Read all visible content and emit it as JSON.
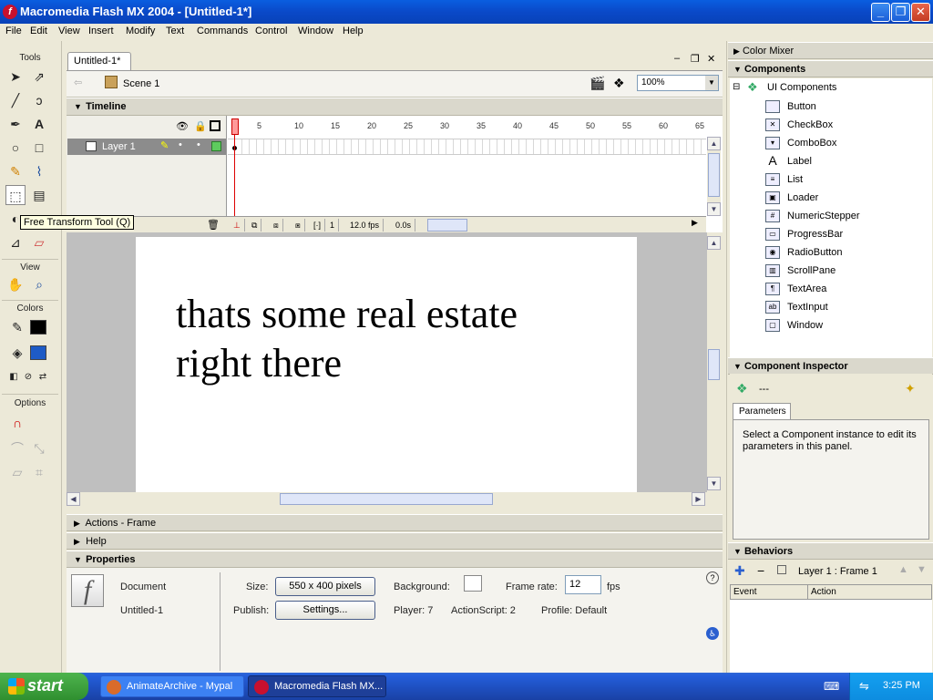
{
  "window": {
    "title": "Macromedia Flash MX 2004 - [Untitled-1*]",
    "minimize": "_",
    "restore": "❐",
    "close": "✕"
  },
  "menu": [
    "File",
    "Edit",
    "View",
    "Insert",
    "Modify",
    "Text",
    "Commands",
    "Control",
    "Window",
    "Help"
  ],
  "tools": {
    "header": "Tools",
    "view_header": "View",
    "colors_header": "Colors",
    "options_header": "Options",
    "tooltip": "Free Transform Tool (Q)",
    "stroke_color": "#000000",
    "fill_color": "#1e5bc6"
  },
  "document": {
    "tab": "Untitled-1*",
    "scene": "Scene 1",
    "zoom": "100%",
    "timeline_title": "Timeline",
    "layer_name": "Layer 1",
    "frame_numbers": [
      "1",
      "5",
      "10",
      "15",
      "20",
      "25",
      "30",
      "35",
      "40",
      "45",
      "50",
      "55",
      "60",
      "65"
    ],
    "current_frame": "1",
    "fps": "12.0 fps",
    "time": "0.0s",
    "stage_text_line1": "thats some real estate",
    "stage_text_line2": "right there"
  },
  "panels": {
    "actions": "Actions - Frame",
    "help": "Help",
    "properties": "Properties"
  },
  "properties": {
    "type": "Document",
    "name": "Untitled-1",
    "size_label": "Size:",
    "size_value": "550 x 400 pixels",
    "publish_label": "Publish:",
    "publish_button": "Settings...",
    "background_label": "Background:",
    "player": "Player: 7",
    "actionscript": "ActionScript:  2",
    "framerate_label": "Frame rate:",
    "framerate_value": "12",
    "fps_unit": "fps",
    "profile": "Profile:  Default"
  },
  "right": {
    "color_mixer": "Color Mixer",
    "components": "Components",
    "ui_components": "UI Components",
    "component_items": [
      "Button",
      "CheckBox",
      "ComboBox",
      "Label",
      "List",
      "Loader",
      "NumericStepper",
      "ProgressBar",
      "RadioButton",
      "ScrollPane",
      "TextArea",
      "TextInput",
      "Window"
    ],
    "inspector": "Component Inspector",
    "inspector_value": "---",
    "parameters_tab": "Parameters",
    "parameters_msg": "Select a Component instance to edit its parameters in this panel.",
    "behaviors": "Behaviors",
    "behaviors_target": "Layer 1 : Frame 1",
    "col_event": "Event",
    "col_action": "Action"
  },
  "taskbar": {
    "start": "start",
    "items": [
      "AnimateArchive - Mypal",
      "Macromedia Flash MX..."
    ],
    "clock": "3:25 PM"
  }
}
